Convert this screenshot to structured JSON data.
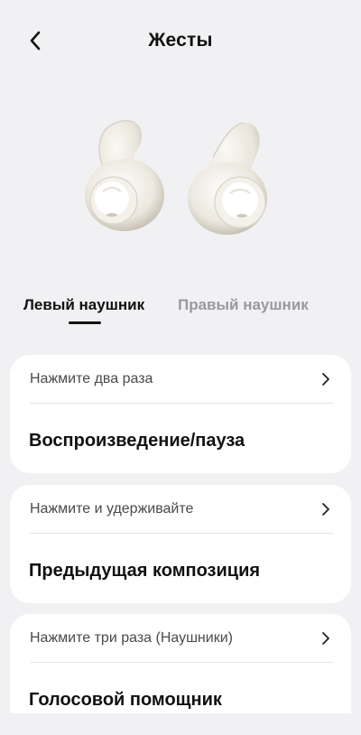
{
  "header": {
    "title": "Жесты"
  },
  "tabs": [
    {
      "label": "Левый наушник",
      "selected": true
    },
    {
      "label": "Правый наушник",
      "selected": false
    }
  ],
  "gestures": [
    {
      "trigger": "Нажмите два раза",
      "action": "Воспроизведение/пауза"
    },
    {
      "trigger": "Нажмите и удерживайте",
      "action": "Предыдущая композиция"
    },
    {
      "trigger": "Нажмите три раза (Наушники)",
      "action": "Голосовой помощник"
    }
  ],
  "icons": {
    "back": "chevron-left-icon",
    "row": "chevron-right-icon"
  }
}
